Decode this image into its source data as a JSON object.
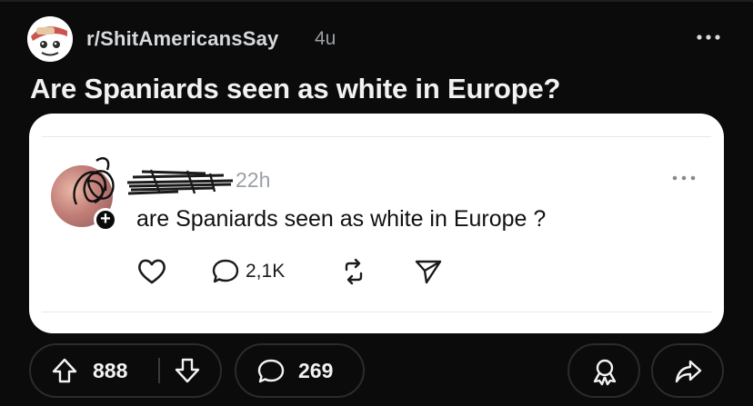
{
  "post": {
    "subreddit": "r/ShitAmericansSay",
    "age": "4u",
    "title": "Are Spaniards seen as white in Europe?"
  },
  "embed": {
    "time": "22h",
    "text": "are Spaniards seen as white in Europe ?",
    "reply_count": "2,1K"
  },
  "actions": {
    "score": "888",
    "comments": "269"
  },
  "icons": [
    "snoo-avatar-icon",
    "more-options-icon",
    "heart-icon",
    "reply-icon",
    "repost-icon",
    "send-icon",
    "upvote-icon",
    "downvote-icon",
    "comment-icon",
    "award-icon",
    "share-icon"
  ]
}
